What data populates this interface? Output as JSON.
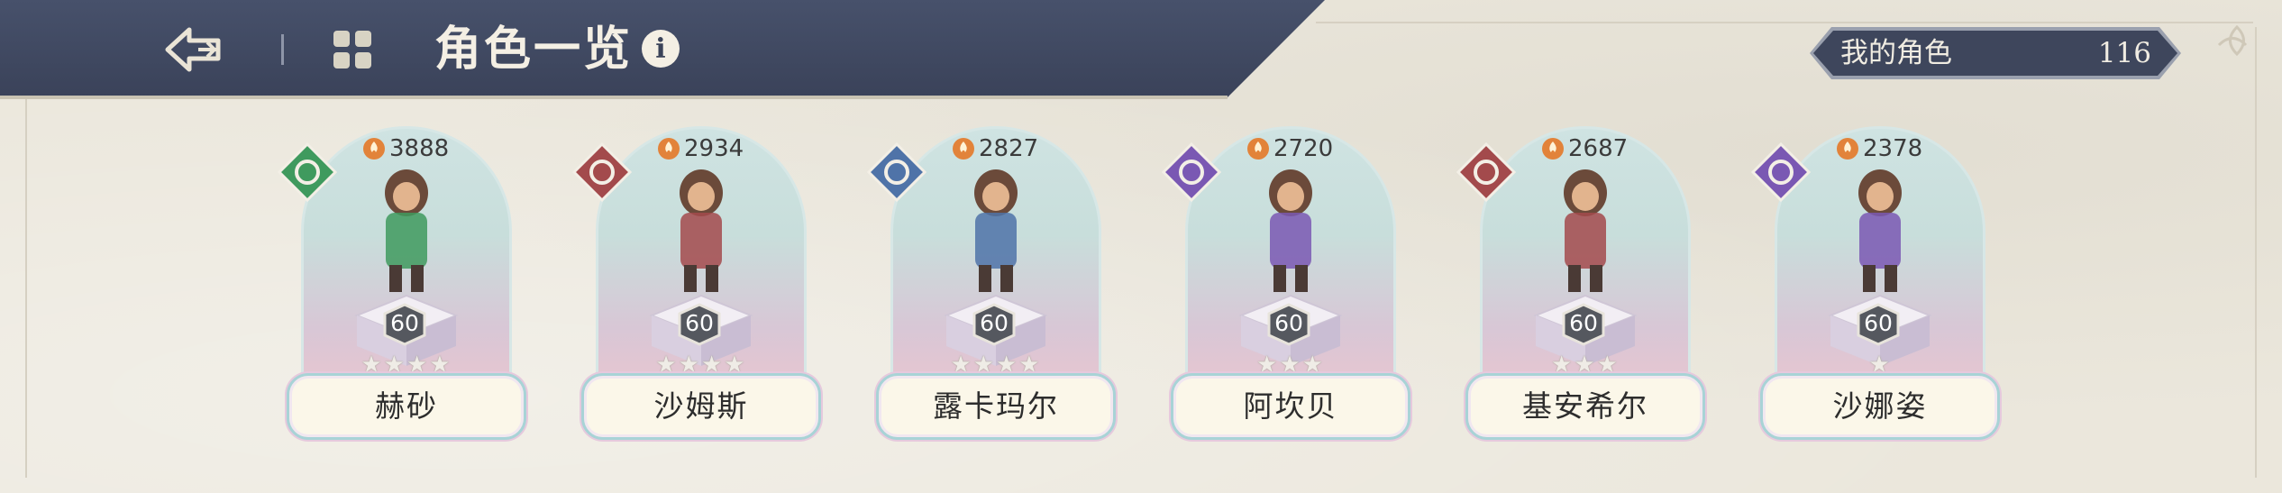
{
  "header": {
    "title": "角色一览",
    "back_icon": "back-arrow-icon",
    "grid_icon": "grid-view-icon",
    "info_label": "i"
  },
  "owned": {
    "label": "我的角色",
    "count": "116"
  },
  "colors": {
    "header_bg": "#3e465c",
    "earth": "#3f9a5e",
    "fire": "#a34a4c",
    "wind": "#4f73a8",
    "arcane": "#7a58b3",
    "star_filled": "#efece6"
  },
  "characters": [
    {
      "name": "赫砂",
      "power": "3888",
      "level": "60",
      "stars": "★★★★",
      "star_count": 4,
      "element": "earth",
      "element_icon": "shield-element-icon"
    },
    {
      "name": "沙姆斯",
      "power": "2934",
      "level": "60",
      "stars": "★★★★",
      "star_count": 4,
      "element": "fire",
      "element_icon": "sword-element-icon"
    },
    {
      "name": "露卡玛尔",
      "power": "2827",
      "level": "60",
      "stars": "★★★★",
      "star_count": 4,
      "element": "wind",
      "element_icon": "cross-element-icon"
    },
    {
      "name": "阿坎贝",
      "power": "2720",
      "level": "60",
      "stars": "★★★",
      "star_count": 3,
      "element": "arcane",
      "element_icon": "swirl-element-icon"
    },
    {
      "name": "基安希尔",
      "power": "2687",
      "level": "60",
      "stars": "★★★",
      "star_count": 3,
      "element": "fire",
      "element_icon": "sword-element-icon"
    },
    {
      "name": "沙娜姿",
      "power": "2378",
      "level": "60",
      "stars": "★",
      "star_count": 1,
      "element": "arcane",
      "element_icon": "swirl-element-icon"
    }
  ]
}
